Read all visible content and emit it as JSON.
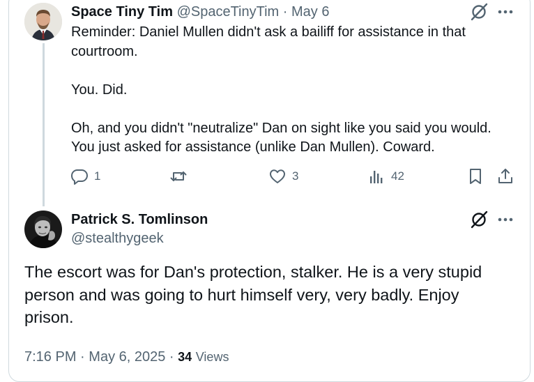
{
  "reply": {
    "display_name": "Space Tiny Tim",
    "handle": "@SpaceTinyTim",
    "separator": "·",
    "date": "May 6",
    "text": "Reminder: Daniel Mullen didn't ask a bailiff for assistance in that courtroom.\n\nYou. Did.\n\nOh, and you didn't \"neutralize\" Dan on sight like you said you would. You just asked for assistance (unlike Dan Mullen). Coward.",
    "actions": {
      "reply_count": "1",
      "retweet_count": "",
      "like_count": "3",
      "views_count": "42"
    }
  },
  "main": {
    "display_name": "Patrick S. Tomlinson",
    "handle": "@stealthygeek",
    "text": "The escort was for Dan's protection, stalker. He is a very stupid person and was going to hurt himself very, very badly. Enjoy prison.",
    "time": "7:16 PM",
    "separator": "·",
    "date": "May 6, 2025",
    "views_count": "34",
    "views_label": "Views"
  },
  "icons": [
    "grok-icon",
    "more-icon",
    "reply-icon",
    "retweet-icon",
    "like-icon",
    "views-icon",
    "bookmark-icon",
    "share-icon"
  ],
  "colors": {
    "text": "#0f1419",
    "muted": "#536471",
    "border": "#cfd9de"
  }
}
